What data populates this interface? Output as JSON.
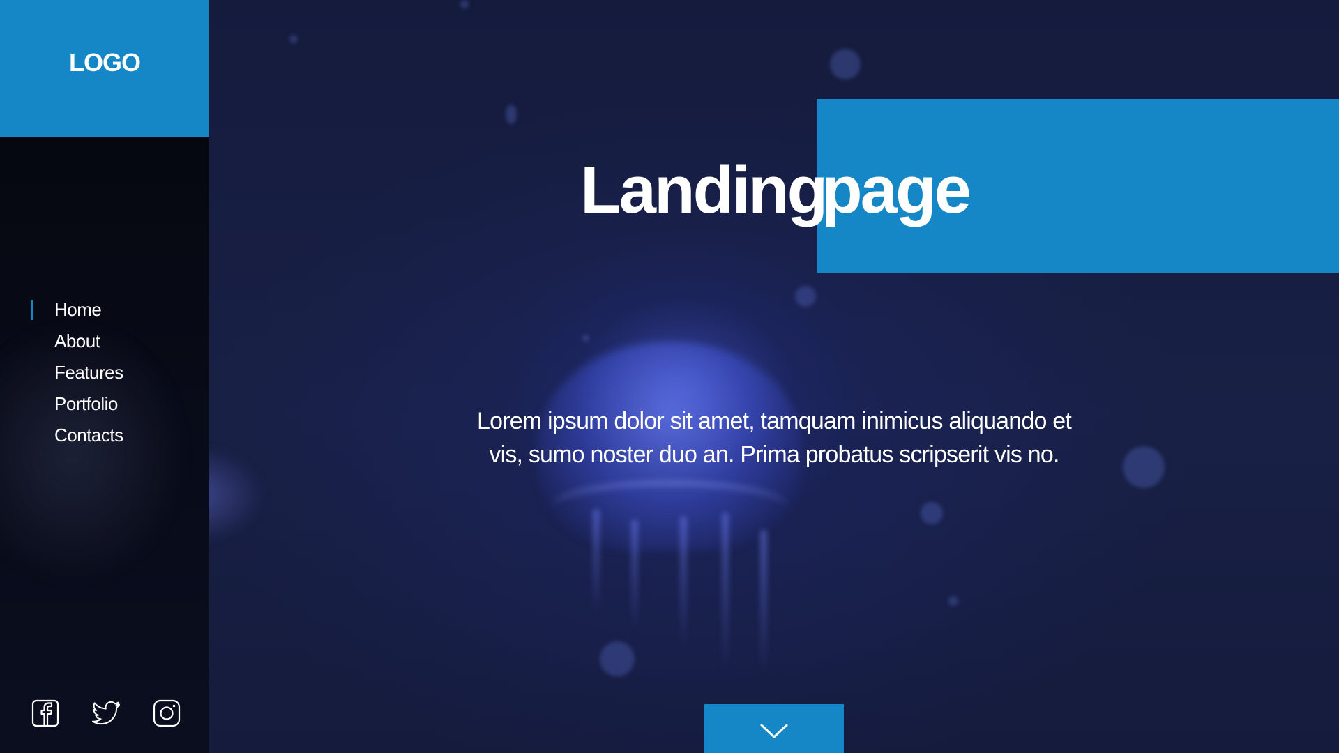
{
  "brand": {
    "logo_text": "LOGO",
    "accent_color": "#1586c6",
    "background_color": "#161c40"
  },
  "sidebar": {
    "nav_items": [
      {
        "label": "Home",
        "active": true
      },
      {
        "label": "About",
        "active": false
      },
      {
        "label": "Features",
        "active": false
      },
      {
        "label": "Portfolio",
        "active": false
      },
      {
        "label": "Contacts",
        "active": false
      }
    ],
    "social_icons": [
      "facebook-icon",
      "twitter-icon",
      "instagram-icon"
    ]
  },
  "hero": {
    "title_word_1": "Landing",
    "title_word_2": "page",
    "lead_line_1": "Lorem ipsum dolor sit amet, tamquam inimicus aliquando et",
    "lead_line_2": "vis, sumo noster duo an. Prima probatus scripserit vis no.",
    "scroll_icon": "chevron-down-icon"
  }
}
